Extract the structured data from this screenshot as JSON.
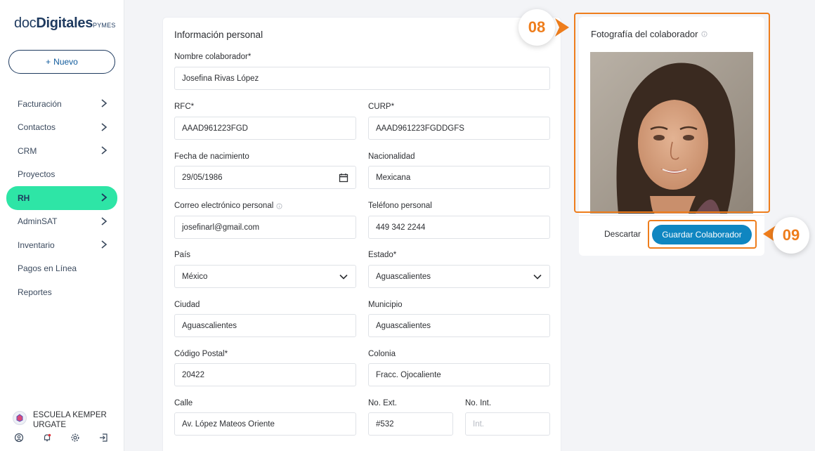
{
  "sidebar": {
    "logo": {
      "part1": "doc",
      "part2": "Digitales",
      "part3": "PYMES"
    },
    "new_button": {
      "icon": "+",
      "label": "Nuevo"
    },
    "items": [
      {
        "label": "Facturación",
        "has_chevron": true
      },
      {
        "label": "Contactos",
        "has_chevron": true
      },
      {
        "label": "CRM",
        "has_chevron": true
      },
      {
        "label": "Proyectos",
        "has_chevron": false
      },
      {
        "label": "RH",
        "has_chevron": true,
        "active": true
      },
      {
        "label": "AdminSAT",
        "has_chevron": true
      },
      {
        "label": "Inventario",
        "has_chevron": true
      },
      {
        "label": "Pagos en Línea",
        "has_chevron": false
      },
      {
        "label": "Reportes",
        "has_chevron": false
      }
    ],
    "company": "ESCUELA KEMPER URGATE",
    "footer_icons": [
      "user-circle-icon",
      "bell-icon",
      "gear-icon",
      "logout-icon"
    ]
  },
  "form": {
    "section_title": "Información personal",
    "fields": {
      "nombre": {
        "label": "Nombre colaborador*",
        "value": "Josefina Rivas López"
      },
      "rfc": {
        "label": "RFC*",
        "value": "AAAD961223FGD"
      },
      "curp": {
        "label": "CURP*",
        "value": "AAAD961223FGDDGFS"
      },
      "fecha": {
        "label": "Fecha de nacimiento",
        "value": "29/05/1986"
      },
      "nacionalidad": {
        "label": "Nacionalidad",
        "value": "Mexicana"
      },
      "correo": {
        "label": "Correo electrónico personal",
        "value": "josefinarl@gmail.com"
      },
      "telefono": {
        "label": "Teléfono personal",
        "value": "449 342 2244"
      },
      "pais": {
        "label": "País",
        "value": "México"
      },
      "estado": {
        "label": "Estado*",
        "value": "Aguascalientes"
      },
      "ciudad": {
        "label": "Ciudad",
        "value": "Aguascalientes"
      },
      "municipio": {
        "label": "Municipio",
        "value": "Aguascalientes"
      },
      "cp": {
        "label": "Código Postal*",
        "value": "20422"
      },
      "colonia": {
        "label": "Colonia",
        "value": "Fracc. Ojocaliente"
      },
      "calle": {
        "label": "Calle",
        "value": "Av. López Mateos Oriente"
      },
      "no_ext": {
        "label": "No. Ext.",
        "value": "#532"
      },
      "no_int": {
        "label": "No. Int.",
        "placeholder": "Int."
      }
    }
  },
  "photo": {
    "title": "Fotografía del colaborador",
    "discard_label": "Descartar",
    "save_label": "Guardar Colaborador"
  },
  "callouts": [
    {
      "number": "08",
      "target": "photo-card"
    },
    {
      "number": "09",
      "target": "save-button"
    }
  ],
  "colors": {
    "accent_orange": "#ee7d1c",
    "active_nav": "#2ee5a6",
    "primary_button": "#0f86c1",
    "brand_navy": "#1e3a5f"
  }
}
